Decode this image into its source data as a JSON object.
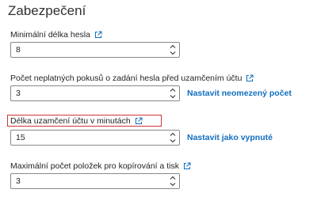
{
  "section": {
    "title": "Zabezpečení"
  },
  "fields": {
    "min_length": {
      "label": "Minimální délka hesla",
      "value": "8"
    },
    "failed_attempts": {
      "label": "Počet neplatných pokusů o zadání hesla před uzamčením účtu",
      "value": "3",
      "link": "Nastavit neomezený počet"
    },
    "lockout_duration": {
      "label": "Délka uzamčení účtu v minutách",
      "value": "15",
      "link": "Nastavit jako vypnuté"
    },
    "max_copy_items": {
      "label": "Maximální počet položek pro kopírování a tisk",
      "value": "3"
    }
  },
  "colors": {
    "link": "#106ebe",
    "highlight": "#d13438",
    "border": "#8a8886"
  },
  "icons": {
    "external": "external-link-icon",
    "up": "chevron-up-icon",
    "down": "chevron-down-icon"
  }
}
